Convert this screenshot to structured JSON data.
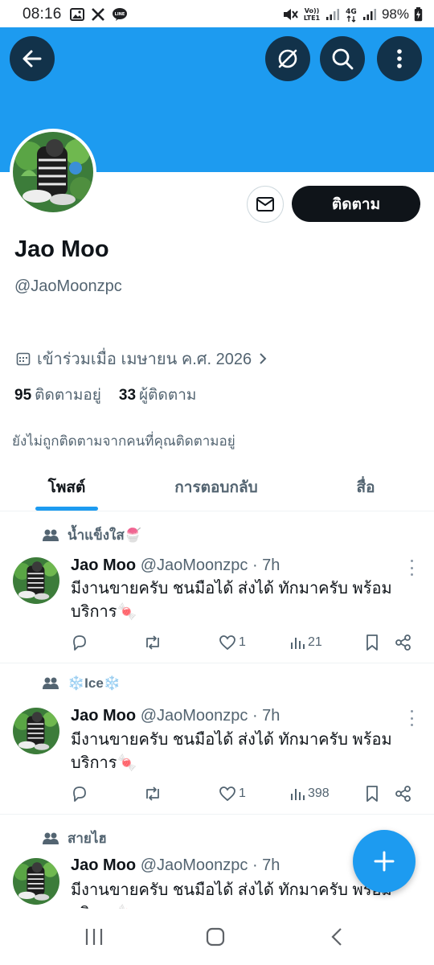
{
  "status": {
    "time": "08:16",
    "volte_label": "Vo))\nLTE1",
    "net_label": "4G",
    "battery": "98%"
  },
  "colors": {
    "accent": "#1d9bf0",
    "banner": "#1d9bf0",
    "text_primary": "#0f1419",
    "text_secondary": "#536471"
  },
  "header": {
    "back_icon": "arrow-left-icon",
    "icons": [
      "no-signal-icon",
      "search-icon",
      "more-vertical-icon"
    ]
  },
  "profile": {
    "name": "Jao Moo",
    "handle": "@JaoMoonzpc",
    "joined": "เข้าร่วมเมื่อ เมษายน ค.ศ. 2026",
    "following_count": "95",
    "following_label": "ติดตามอยู่",
    "followers_count": "33",
    "followers_label": "ผู้ติดตาม",
    "not_followed": "ยังไม่ถูกติดตามจากคนที่คุณติดตามอยู่",
    "follow_button": "ติดตาม"
  },
  "tabs": [
    {
      "label": "โพสต์",
      "active": true
    },
    {
      "label": "การตอบกลับ",
      "active": false
    },
    {
      "label": "สื่อ",
      "active": false
    }
  ],
  "posts": [
    {
      "community": "น้ำแข็งใส🍧",
      "name": "Jao Moo",
      "handle": "@JaoMoonzpc · 7h",
      "text": "มีงานขายครับ ชนมือได้ ส่งได้  ทักมาครับ พร้อมบริการ🍬",
      "likes": "1",
      "views": "21"
    },
    {
      "community": "❄️Ice❄️",
      "name": "Jao Moo",
      "handle": "@JaoMoonzpc · 7h",
      "text": "มีงานขายครับ  ชนมือได้ ส่งได้ ทักมาครับ พร้อมบริการ🍬",
      "likes": "1",
      "views": "398"
    },
    {
      "community": "สายไฮ",
      "name": "Jao Moo",
      "handle": "@JaoMoonzpc · 7h",
      "text": "มีงานขายครับ ชนมือได้ ส่งได้ ทักมาครับ พร้อมบริการ🍬"
    }
  ]
}
